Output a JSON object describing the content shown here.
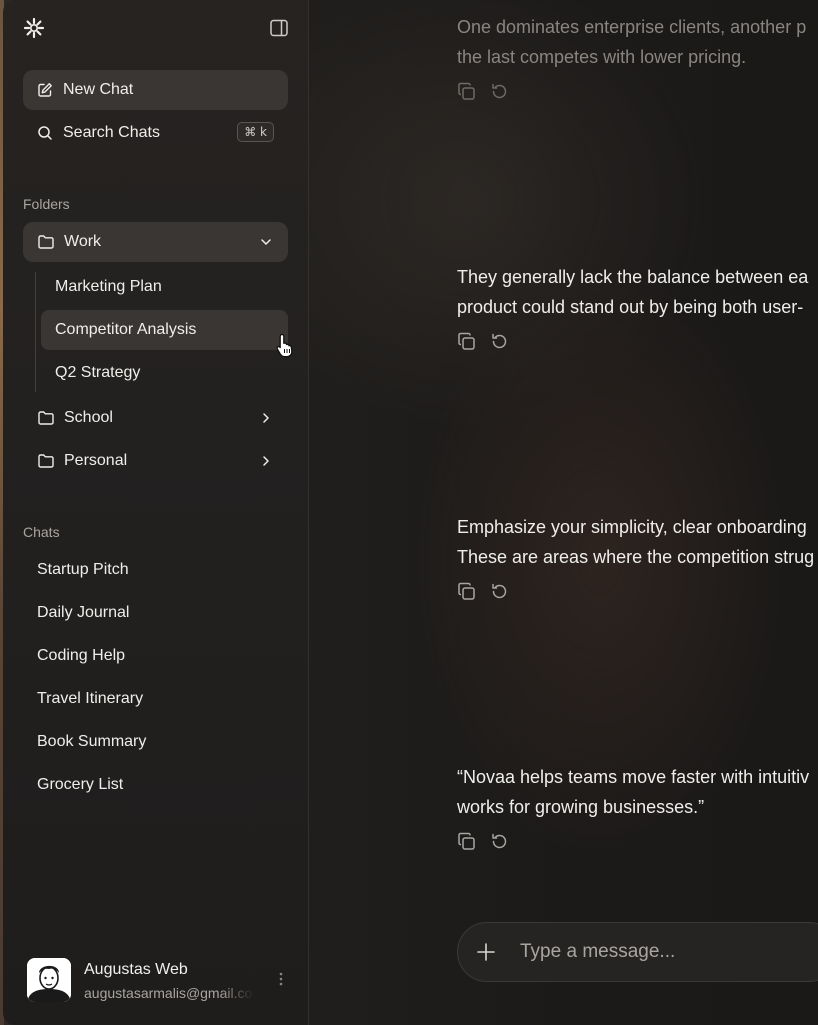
{
  "sidebar": {
    "new_chat": "New Chat",
    "search_chats": "Search Chats",
    "search_shortcut": "⌘ k",
    "folders_label": "Folders",
    "folders": [
      {
        "label": "Work",
        "expanded": true,
        "items": [
          "Marketing Plan",
          "Competitor Analysis",
          "Q2 Strategy"
        ]
      },
      {
        "label": "School",
        "expanded": false
      },
      {
        "label": "Personal",
        "expanded": false
      }
    ],
    "chats_label": "Chats",
    "chats": [
      "Startup Pitch",
      "Daily Journal",
      "Coding Help",
      "Travel Itinerary",
      "Book Summary",
      "Grocery List"
    ],
    "user": {
      "name": "Augustas Web",
      "email": "augustasarmalis@gmail.com"
    }
  },
  "messages": [
    {
      "lines": [
        "One dominates enterprise clients, another p",
        "the last competes with lower pricing."
      ],
      "faded": true
    },
    {
      "lines": [
        "They generally lack the balance between ea",
        "product could stand out by being both user-"
      ]
    },
    {
      "lines": [
        "Emphasize your simplicity, clear onboarding",
        "These are areas where the competition strug"
      ]
    },
    {
      "lines": [
        "“Novaa helps teams move faster with intuitiv",
        "works for growing businesses.”"
      ]
    }
  ],
  "composer": {
    "placeholder": "Type a message..."
  },
  "colors": {
    "sidebar_bg": "#232120",
    "active_item": "#3a3633",
    "text": "#f0eeeb",
    "muted": "#a9a5a1"
  }
}
